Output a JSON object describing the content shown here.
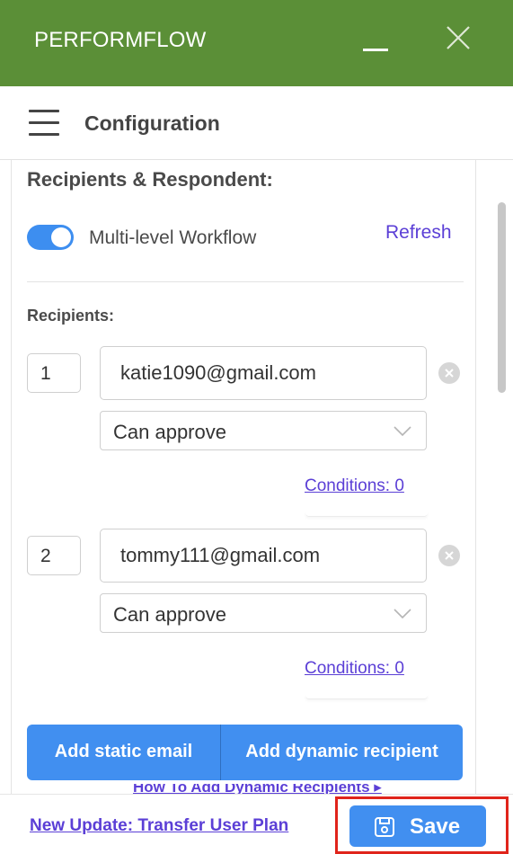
{
  "app": {
    "title": "PERFORMFLOW",
    "minimize_icon": "minimize-icon",
    "close_icon": "close-icon"
  },
  "header": {
    "menu_icon": "hamburger-menu-icon",
    "title": "Configuration"
  },
  "section": {
    "title": "Recipients & Respondent:",
    "toggle": {
      "label": "Multi-level Workflow",
      "on": true
    },
    "refresh_label": "Refresh",
    "recipients_title": "Recipients:"
  },
  "recipients": [
    {
      "order": "1",
      "email": "katie1090@gmail.com",
      "permission": "Can approve",
      "conditions": "Conditions: 0"
    },
    {
      "order": "2",
      "email": "tommy111@gmail.com",
      "permission": "Can approve",
      "conditions": "Conditions: 0"
    }
  ],
  "buttons": {
    "add_static": "Add static email",
    "add_dynamic": "Add dynamic recipient"
  },
  "partial_link": "How To Add Dynamic Recipients ▸",
  "footer": {
    "update_link": "New Update: Transfer User Plan",
    "save_label": "Save",
    "save_icon": "save-disk-icon"
  },
  "colors": {
    "titlebar": "#5b8f37",
    "accent": "#418ff0",
    "link": "#5b3fd6",
    "highlight": "#e0241b"
  }
}
